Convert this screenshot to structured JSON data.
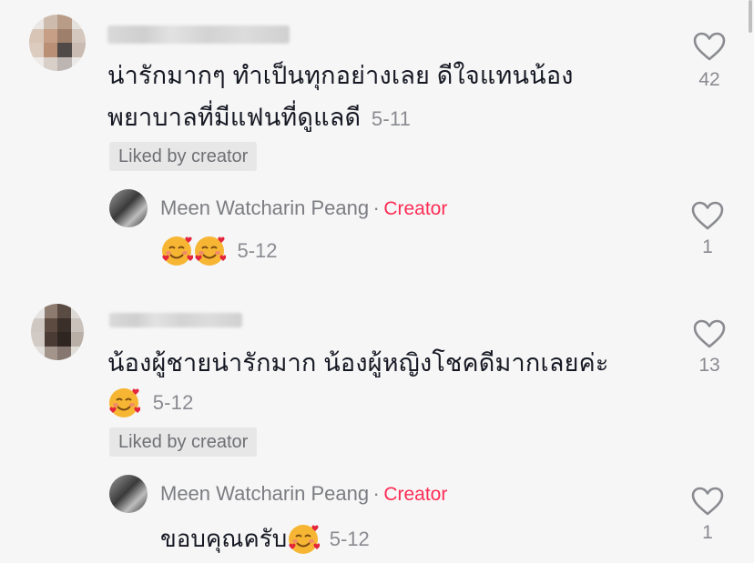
{
  "comments": [
    {
      "text_line1": "น่ารักมากๆ ทำเป็นทุกอย่างเลย ดีใจแทนน้อง",
      "text_line2": "พยาบาลที่มีแฟนที่ดูแลดี",
      "date": "5-11",
      "liked_badge": "Liked by creator",
      "like_count": "42",
      "reply": {
        "author": "Meen Watcharin Peang",
        "separator": "·",
        "creator_label": "Creator",
        "text": "",
        "date": "5-12",
        "like_count": "1"
      }
    },
    {
      "text_line1": "น้องผู้ชายน่ารักมาก น้องผู้หญิงโชคดีมากเลยค่ะ",
      "date": "5-12",
      "liked_badge": "Liked by creator",
      "like_count": "13",
      "reply": {
        "author": "Meen Watcharin Peang",
        "separator": "·",
        "creator_label": "Creator",
        "text": "ขอบคุณครับ",
        "date": "5-12",
        "like_count": "1"
      }
    }
  ],
  "icons": {
    "like": "heart-outline-icon",
    "emoji": "smiling-face-with-hearts-emoji"
  },
  "colors": {
    "creator": "#fe2c55",
    "background": "#f6f6f6",
    "muted": "#8a8b91"
  }
}
